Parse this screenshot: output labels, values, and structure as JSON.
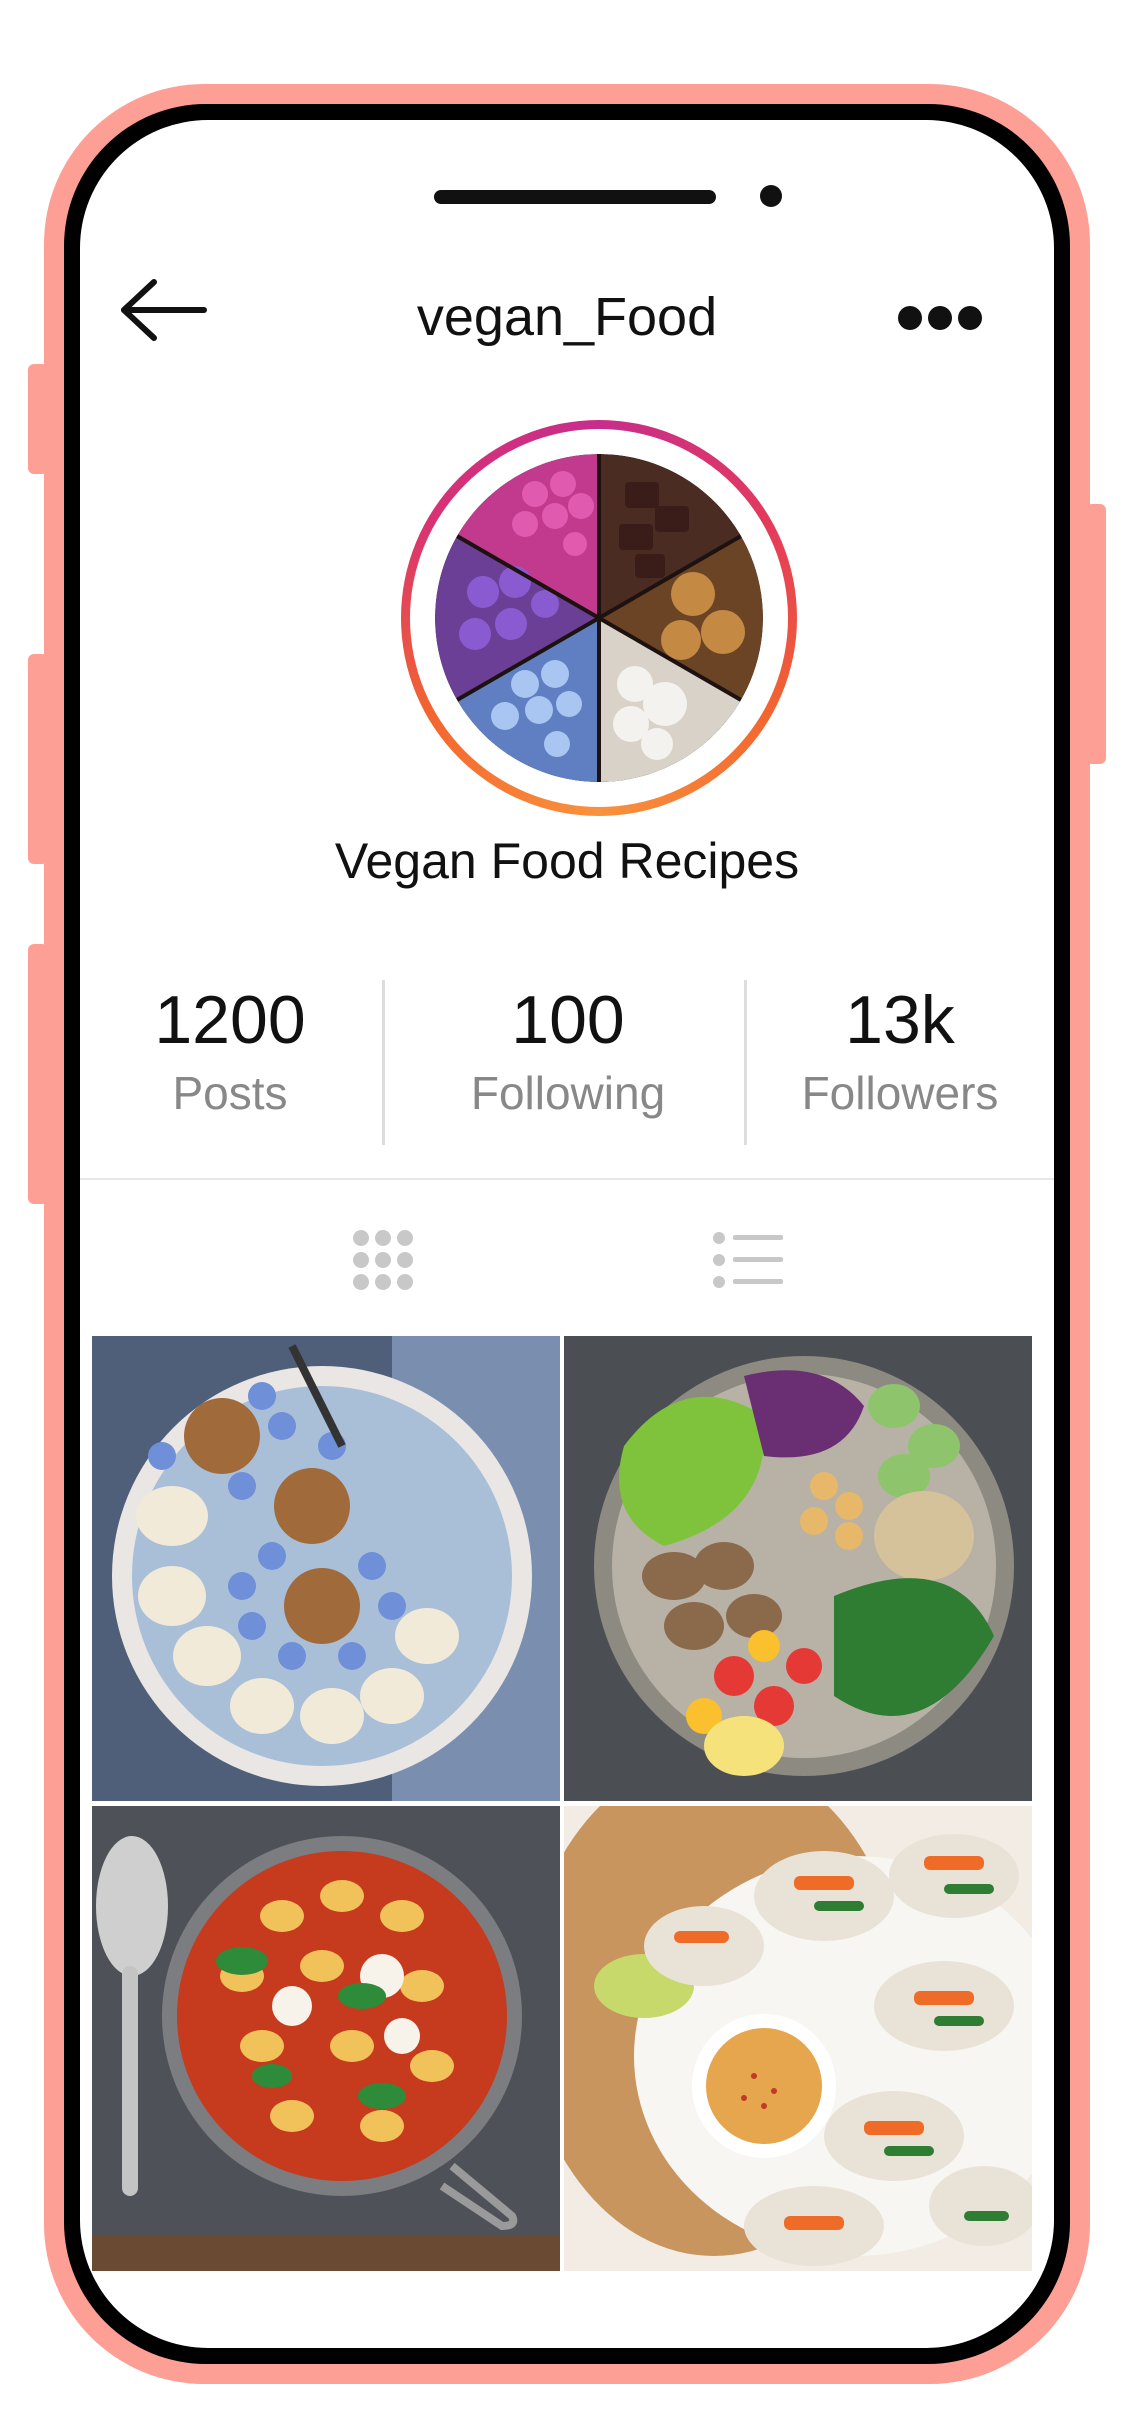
{
  "profile": {
    "username": "vegan_Food",
    "full_name": "Vegan Food Recipes"
  },
  "stats": [
    {
      "value": "1200",
      "label": "Posts"
    },
    {
      "value": "100",
      "label": "Following"
    },
    {
      "value": "13k",
      "label": "Followers"
    }
  ],
  "icons": {
    "back": "arrow-left-icon",
    "more": "more-horizontal-icon",
    "grid_view": "grid-icon",
    "list_view": "list-icon"
  },
  "colors": {
    "phone_frame": "#fe9f96",
    "ring_start": "#c72d8c",
    "ring_end": "#f9923c",
    "label_gray": "#888888"
  },
  "posts": [
    {
      "name": "smoothie-bowl-photo"
    },
    {
      "name": "salad-bowl-photo"
    },
    {
      "name": "gnocchi-pan-photo"
    },
    {
      "name": "spring-rolls-photo"
    }
  ]
}
